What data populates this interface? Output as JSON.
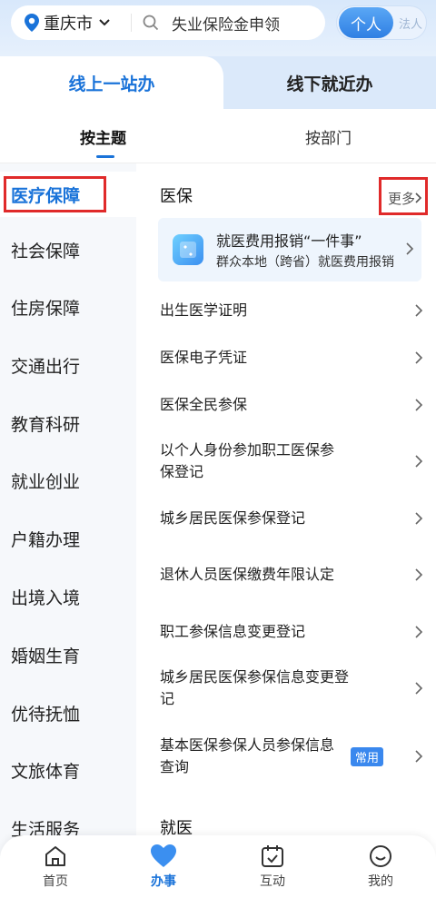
{
  "header": {
    "city": "重庆市",
    "search_text": "失业保险金申领",
    "role_active": "个人",
    "role_inactive": "法人"
  },
  "channel_tabs": {
    "online": "线上一站办",
    "offline": "线下就近办"
  },
  "sub_tabs": {
    "by_topic": "按主题",
    "by_dept": "按部门"
  },
  "sidebar": {
    "items": [
      {
        "label": "医疗保障"
      },
      {
        "label": "社会保障"
      },
      {
        "label": "住房保障"
      },
      {
        "label": "交通出行"
      },
      {
        "label": "教育科研"
      },
      {
        "label": "就业创业"
      },
      {
        "label": "户籍办理"
      },
      {
        "label": "出境入境"
      },
      {
        "label": "婚姻生育"
      },
      {
        "label": "优待抚恤"
      },
      {
        "label": "文旅体育"
      },
      {
        "label": "生活服务"
      }
    ]
  },
  "content": {
    "section_title": "医保",
    "more_label": "更多",
    "banner": {
      "title": "就医费用报销“一件事”",
      "subtitle": "群众本地（跨省）就医费用报销"
    },
    "items": [
      {
        "label": "出生医学证明"
      },
      {
        "label": "医保电子凭证"
      },
      {
        "label": "医保全民参保"
      },
      {
        "label": "以个人身份参加职工医保参保登记"
      },
      {
        "label": "城乡居民医保参保登记"
      },
      {
        "label": "退休人员医保缴费年限认定"
      },
      {
        "label": "职工参保信息变更登记"
      },
      {
        "label": "城乡居民医保参保信息变更登记"
      },
      {
        "label": "基本医保参保人员参保信息查询",
        "badge": "常用"
      }
    ],
    "next_section_partial": "就医"
  },
  "bottom_nav": {
    "home": "首页",
    "affairs": "办事",
    "interact": "互动",
    "mine": "我的"
  },
  "colors": {
    "accent": "#1a73d9",
    "highlight_box": "#e02a2a"
  }
}
